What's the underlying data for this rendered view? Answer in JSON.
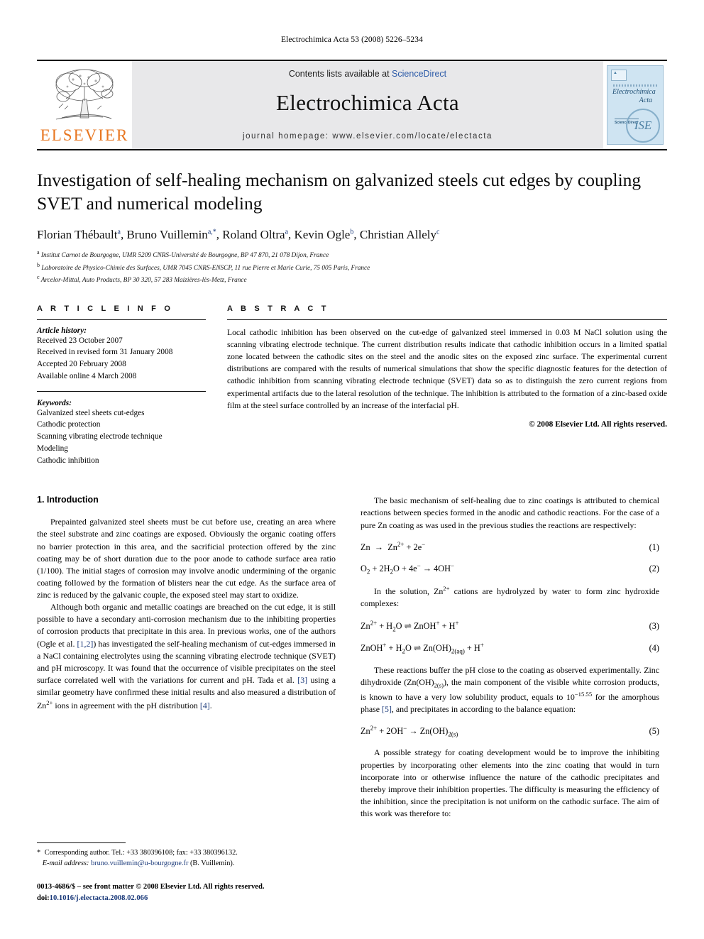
{
  "running_head": "Electrochimica Acta 53 (2008) 5226–5234",
  "masthead": {
    "publisher_name": "ELSEVIER",
    "contents_prefix": "Contents lists available at ",
    "sciencedirect": "ScienceDirect",
    "journal_title": "Electrochimica Acta",
    "homepage": "journal homepage: www.elsevier.com/locate/electacta",
    "cover": {
      "title_line1": "Electrochimica",
      "title_line2": "Acta",
      "small_label": "ScienceDirect",
      "society_mark": "ISE"
    }
  },
  "article": {
    "title": "Investigation of self-healing mechanism on galvanized steels cut edges by coupling SVET and numerical modeling",
    "authors_html": "Florian Thébault<sup>a</sup>, Bruno Vuillemin<sup>a,*</sup>, Roland Oltra<sup>a</sup>, Kevin Ogle<sup>b</sup>, Christian Allely<sup>c</sup>",
    "affiliations": [
      "Institut Carnot de Bourgogne, UMR 5209 CNRS-Université de Bourgogne, BP 47 870, 21 078 Dijon, France",
      "Laboratoire de Physico-Chimie des Surfaces, UMR 7045 CNRS-ENSCP, 11 rue Pierre et Marie Curie, 75 005 Paris, France",
      "Arcelor-Mittal, Auto Products, BP 30 320, 57 283 Maizières-lès-Metz, France"
    ],
    "affiliation_marks": [
      "a",
      "b",
      "c"
    ]
  },
  "info": {
    "heading": "A R T I C L E    I N F O",
    "history_label": "Article history:",
    "history": [
      "Received 23 October 2007",
      "Received in revised form 31 January 2008",
      "Accepted 20 February 2008",
      "Available online 4 March 2008"
    ],
    "keywords_label": "Keywords:",
    "keywords": [
      "Galvanized steel sheets cut-edges",
      "Cathodic protection",
      "Scanning vibrating electrode technique",
      "Modeling",
      "Cathodic inhibition"
    ]
  },
  "abstract": {
    "heading": "A B S T R A C T",
    "text": "Local cathodic inhibition has been observed on the cut-edge of galvanized steel immersed in 0.03 M NaCl solution using the scanning vibrating electrode technique. The current distribution results indicate that cathodic inhibition occurs in a limited spatial zone located between the cathodic sites on the steel and the anodic sites on the exposed zinc surface. The experimental current distributions are compared with the results of numerical simulations that show the specific diagnostic features for the detection of cathodic inhibition from scanning vibrating electrode technique (SVET) data so as to distinguish the zero current regions from experimental artifacts due to the lateral resolution of the technique. The inhibition is attributed to the formation of a zinc-based oxide film at the steel surface controlled by an increase of the interfacial pH.",
    "copyright": "© 2008 Elsevier Ltd. All rights reserved."
  },
  "body": {
    "section_number_title": "1. Introduction",
    "left_paragraphs": [
      "Prepainted galvanized steel sheets must be cut before use, creating an area where the steel substrate and zinc coatings are exposed. Obviously the organic coating offers no barrier protection in this area, and the sacrificial protection offered by the zinc coating may be of short duration due to the poor anode to cathode surface area ratio (1/100). The initial stages of corrosion may involve anodic undermining of the organic coating followed by the formation of blisters near the cut edge. As the surface area of zinc is reduced by the galvanic couple, the exposed steel may start to oxidize."
    ],
    "left_para2_parts": {
      "a": "Although both organic and metallic coatings are breached on the cut edge, it is still possible to have a secondary anti-corrosion mechanism due to the inhibiting properties of corrosion products that precipitate in this area. In previous works, one of the authors (Ogle et al. ",
      "ref1": "[1,2]",
      "b": ") has investigated the self-healing mechanism of cut-edges immersed in a NaCl containing electrolytes using the scanning vibrating electrode technique (SVET) and pH microscopy. It was found that the occurrence of visible precipitates on the steel surface correlated well with the variations for current and pH. Tada et al. ",
      "ref2": "[3]",
      "c": " using a similar geometry have confirmed these initial results and also measured a distribution of Zn",
      "zn_sup": "2+",
      "d": " ions in agreement with the pH distribution ",
      "ref3": "[4]",
      "e": "."
    },
    "right_para1": "The basic mechanism of self-healing due to zinc coatings is attributed to chemical reactions between species formed in the anodic and cathodic reactions. For the case of a pure Zn coating as was used in the previous studies the reactions are respectively:",
    "right_para2": "In the solution, Zn²⁺ cations are hydrolyzed by water to form zinc hydroxide complexes:",
    "right_para3_parts": {
      "a": "These reactions buffer the pH close to the coating as observed experimentally. Zinc dihydroxide (Zn(OH)",
      "sub1": "2(s)",
      "b": "), the main component of the visible white corrosion products, is known to have a very low solubility product, equals to 10",
      "sup1": "−15.55",
      "c": " for the amorphous phase ",
      "ref": "[5]",
      "d": ", and precipitates in according to the balance equation:"
    },
    "right_para4": "A possible strategy for coating development would be to improve the inhibiting properties by incorporating other elements into the zinc coating that would in turn incorporate into or otherwise influence the nature of the cathodic precipitates and thereby improve their inhibition properties. The difficulty is measuring the efficiency of the inhibition, since the precipitation is not uniform on the cathodic surface. The aim of this work was therefore to:",
    "equations": [
      {
        "number": "(1)",
        "text": "Zn → Zn2+ + 2e−"
      },
      {
        "number": "(2)",
        "text": "O2 + 2H2O + 4e− → 4OH−"
      },
      {
        "number": "(3)",
        "text": "Zn2+ + H2O ⇄ ZnOH+ + H+"
      },
      {
        "number": "(4)",
        "text": "ZnOH+ + H2O ⇄ Zn(OH)2(aq) + H+"
      },
      {
        "number": "(5)",
        "text": "Zn2+ + 2OH− → Zn(OH)2(s)"
      }
    ]
  },
  "footer": {
    "corresponding_star": "*",
    "corresponding_text": " Corresponding author. Tel.: +33 380396108; fax: +33 380396132.",
    "email_label": "E-mail address:",
    "email": "bruno.vuillemin@u-bourgogne.fr",
    "email_owner": " (B. Vuillemin).",
    "issn_line": "0013-4686/$ – see front matter © 2008 Elsevier Ltd. All rights reserved.",
    "doi_prefix": "doi:",
    "doi": "10.1016/j.electacta.2008.02.066"
  }
}
